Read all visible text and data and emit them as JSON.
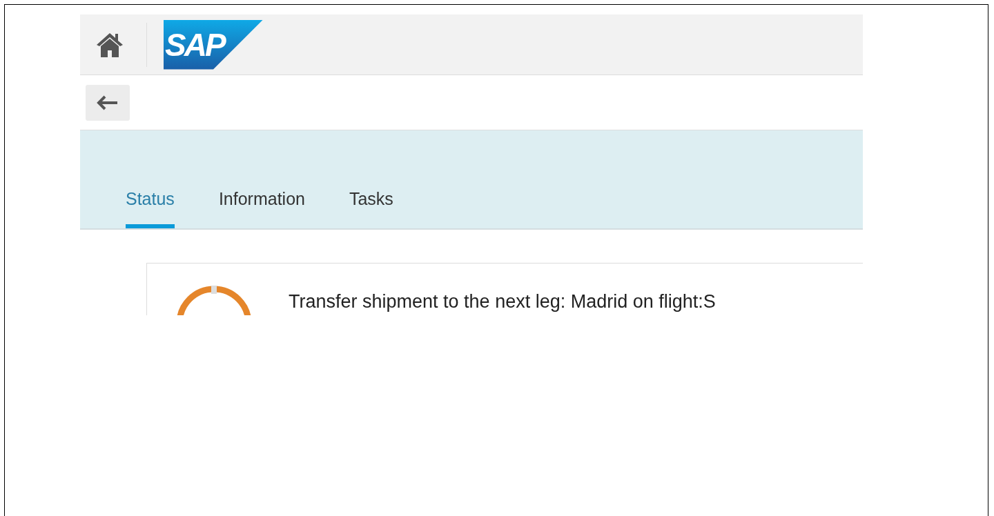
{
  "header": {
    "logo": "SAP"
  },
  "tabs": [
    {
      "label": "Status",
      "selected": true
    },
    {
      "label": "Information",
      "selected": false
    },
    {
      "label": "Tasks",
      "selected": false
    }
  ],
  "card": {
    "title": "Transfer shipment to the next leg: Madrid on flight:S"
  }
}
